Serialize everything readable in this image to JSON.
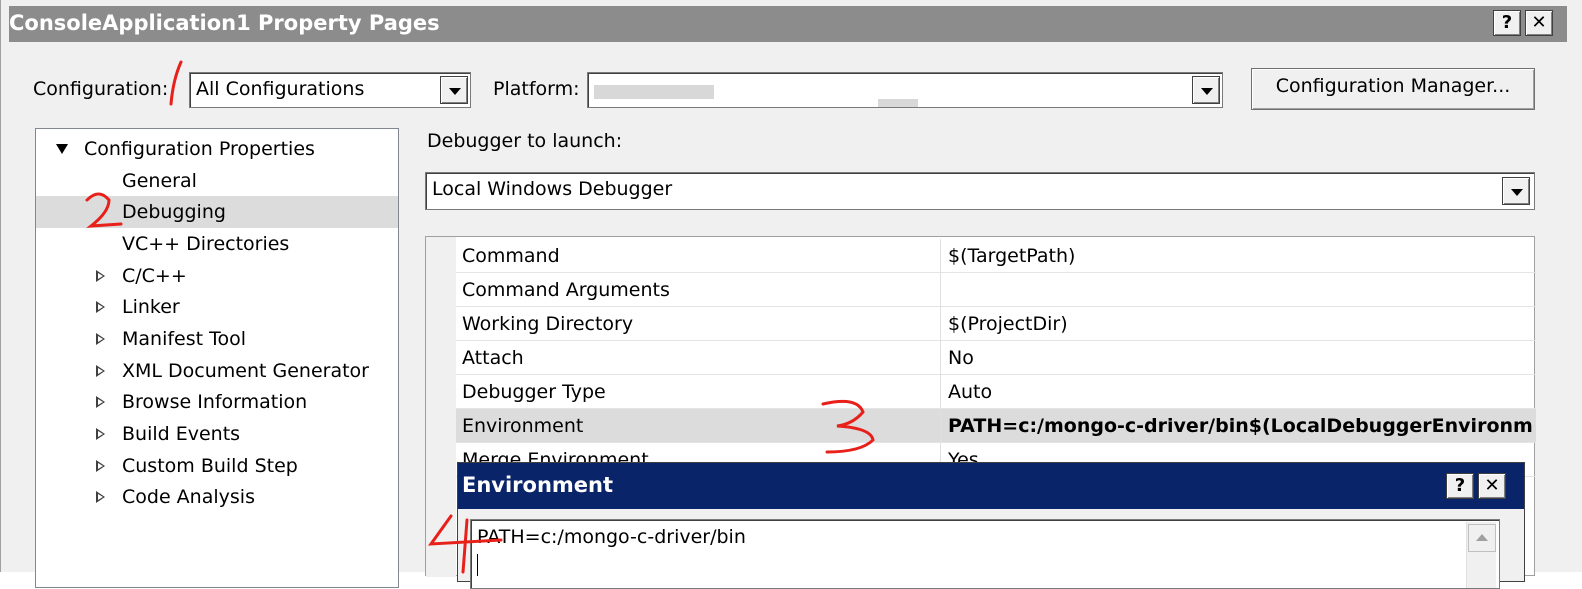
{
  "window": {
    "title": "ConsoleApplication1 Property Pages",
    "help_label": "?",
    "close_label": "✕"
  },
  "toolbar": {
    "configuration_label": "Configuration:",
    "configuration_value": "All Configurations",
    "platform_label": "Platform:",
    "platform_value": "",
    "config_manager_label": "Configuration Manager..."
  },
  "tree": {
    "root": "Configuration Properties",
    "items": [
      {
        "label": "General",
        "expandable": false
      },
      {
        "label": "Debugging",
        "expandable": false,
        "selected": true
      },
      {
        "label": "VC++ Directories",
        "expandable": false
      },
      {
        "label": "C/C++",
        "expandable": true
      },
      {
        "label": "Linker",
        "expandable": true
      },
      {
        "label": "Manifest Tool",
        "expandable": true
      },
      {
        "label": "XML Document Generator",
        "expandable": true
      },
      {
        "label": "Browse Information",
        "expandable": true
      },
      {
        "label": "Build Events",
        "expandable": true
      },
      {
        "label": "Custom Build Step",
        "expandable": true
      },
      {
        "label": "Code Analysis",
        "expandable": true
      }
    ]
  },
  "debugger": {
    "launch_label": "Debugger to launch:",
    "launch_value": "Local Windows Debugger"
  },
  "grid": {
    "rows": [
      {
        "name": "Command",
        "value": "$(TargetPath)"
      },
      {
        "name": "Command Arguments",
        "value": ""
      },
      {
        "name": "Working Directory",
        "value": "$(ProjectDir)"
      },
      {
        "name": "Attach",
        "value": "No"
      },
      {
        "name": "Debugger Type",
        "value": "Auto"
      },
      {
        "name": "Environment",
        "value": "PATH=c:/mongo-c-driver/bin$(LocalDebuggerEnvironment)",
        "selected": true,
        "bold": true
      },
      {
        "name": "Merge Environment",
        "value": "Yes"
      }
    ]
  },
  "env_dialog": {
    "title": "Environment",
    "help_label": "?",
    "close_label": "✕",
    "text": "PATH=c:/mongo-c-driver/bin"
  },
  "annotations": {
    "color": "#e8201a"
  },
  "colors": {
    "titlebar": "#8c8c8c",
    "dialog_titlebar": "#0a246a",
    "selection": "#dcdcdc"
  }
}
